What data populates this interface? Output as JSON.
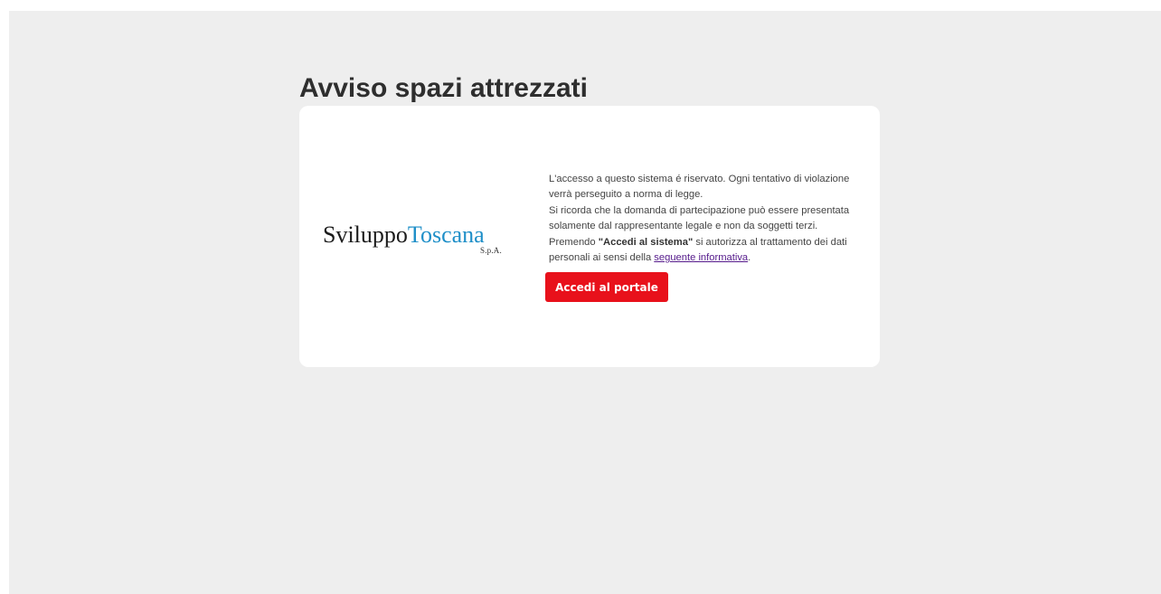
{
  "page": {
    "title": "Avviso spazi attrezzati"
  },
  "logo": {
    "word_dark": "Sviluppo",
    "word_blue": "Toscana",
    "suffix": "S.p.A.",
    "colors": {
      "dark": "#1b1b1b",
      "blue": "#1f8fc8"
    }
  },
  "notice": {
    "line1": "L'accesso a questo sistema é riservato. Ogni tentativo di violazione verrà perseguito a norma di legge.",
    "line2": "Si ricorda che la domanda di partecipazione può essere presentata solamente dal rappresentante legale e non da soggetti terzi.",
    "line3_prefix": "Premendo ",
    "line3_bold": "\"Accedi al sistema\"",
    "line3_middle": " si autorizza al trattamento dei dati personali ai sensi della ",
    "line3_link": "seguente informativa",
    "line3_suffix": "."
  },
  "actions": {
    "login_label": "Accedi al portale"
  },
  "colors": {
    "background": "#eeeeee",
    "card": "#ffffff",
    "button": "#e8111b",
    "link": "#551a8b"
  }
}
